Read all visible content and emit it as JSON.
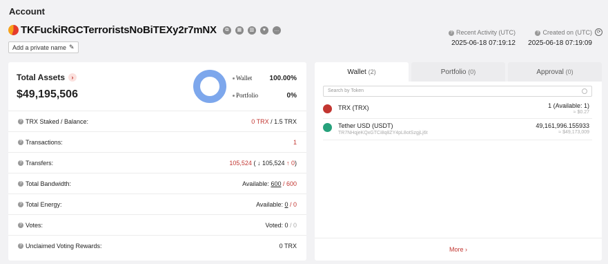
{
  "page": {
    "title": "Account"
  },
  "account": {
    "address": "TKFuckiRGCTerroristsNoBiTEXy2r7mNX",
    "private_name_label": "Add a private name",
    "recent_activity_label": "Recent Activity (UTC)",
    "recent_activity_value": "2025-06-18 07:19:12",
    "created_on_label": "Created on (UTC)",
    "created_on_value": "2025-06-18 07:19:09"
  },
  "assets": {
    "label": "Total Assets",
    "value": "$49,195,506",
    "legend": [
      {
        "name": "Wallet",
        "percent": "100.00%"
      },
      {
        "name": "Portfolio",
        "percent": "0%"
      }
    ],
    "rows": [
      {
        "label": "TRX Staked / Balance:",
        "v1": "0 TRX",
        "v2": " / 1.5 TRX"
      },
      {
        "label": "Transactions:",
        "v1": "1"
      },
      {
        "label": "Transfers:",
        "v1": "105,524",
        "v2": "( ↓ 105,524 ",
        "v3": "↑ 0",
        "v4": ")"
      },
      {
        "label": "Total Bandwidth:",
        "v1": "Available: ",
        "v2": "600",
        "v3": " / 600"
      },
      {
        "label": "Total Energy:",
        "v1": "Available: ",
        "v2": "0",
        "v3": " / 0"
      },
      {
        "label": "Votes:",
        "v1": "Voted: ",
        "v2": "0",
        "v3": " / 0"
      },
      {
        "label": "Unclaimed Voting Rewards:",
        "v1": "0 TRX"
      }
    ]
  },
  "tabs": [
    {
      "label": "Wallet",
      "count": "(2)"
    },
    {
      "label": "Portfolio",
      "count": "(0)"
    },
    {
      "label": "Approval",
      "count": "(0)"
    }
  ],
  "wallet": {
    "search_placeholder": "Search by Token",
    "tokens": [
      {
        "name": "TRX (TRX)",
        "amount": "1 (Available: 1)",
        "usd": "≈ $0.27",
        "icon": "trx-icon",
        "color": "#c23631"
      },
      {
        "name": "Tether USD (USDT)",
        "contract": "TR7NHqjeKQxGTCi8q8ZY4pL8otSzgjLj6t",
        "amount": "49,161,996.155933",
        "usd": "≈ $49,173,009",
        "icon": "usdt-icon",
        "color": "#26a17b"
      }
    ],
    "more_label": "More ›"
  },
  "colors": {
    "accent": "#c23631",
    "donut": "#7da7ec"
  }
}
